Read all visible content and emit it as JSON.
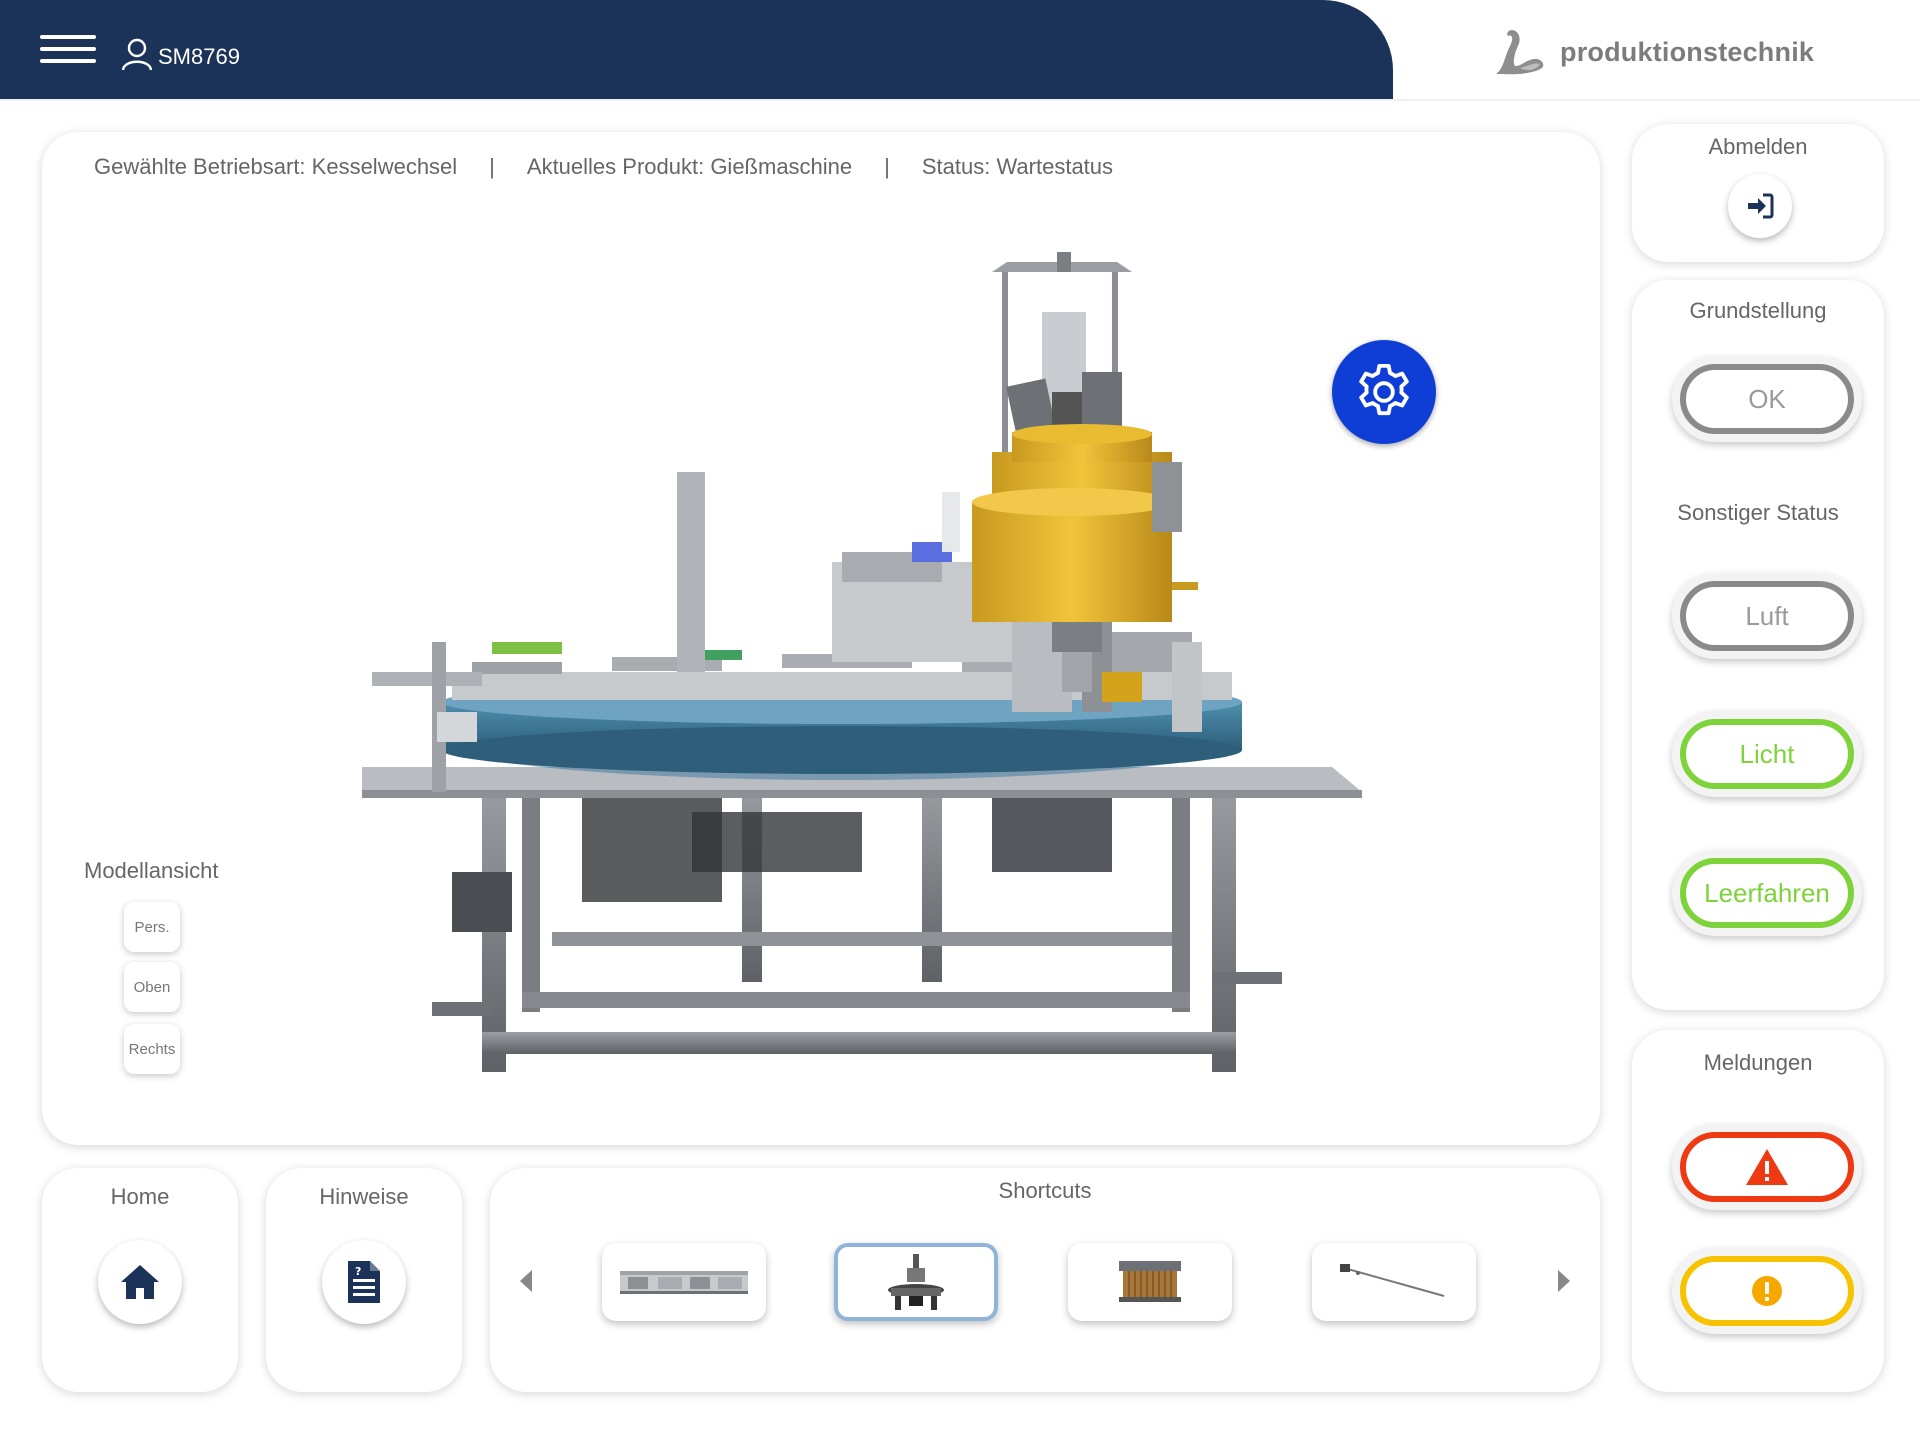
{
  "header": {
    "user": "SM8769",
    "brand": "produktionstechnik"
  },
  "viewer": {
    "mode": "Gewählte Betriebsart: Kesselwechsel",
    "product": "Aktuelles Produkt: Gießmaschine",
    "status": "Status: Wartestatus",
    "separator": "|",
    "model_view_label": "Modellansicht",
    "view_buttons": [
      "Pers.",
      "Oben",
      "Rechts"
    ]
  },
  "logout": {
    "title": "Abmelden"
  },
  "status_panel": {
    "home_position_title": "Grundstellung",
    "ok_label": "OK",
    "other_status_title": "Sonstiger Status",
    "air_label": "Luft",
    "light_label": "Licht",
    "empty_run_label": "Leerfahren"
  },
  "messages": {
    "title": "Meldungen"
  },
  "bottom": {
    "home_title": "Home",
    "hints_title": "Hinweise",
    "shortcuts_title": "Shortcuts"
  },
  "colors": {
    "header_bg": "#1b3358",
    "accent_blue": "#0f3ed6",
    "green": "#7ed23a",
    "red": "#ee3a12",
    "yellow": "#f7c200",
    "gray": "#8a8a8a"
  }
}
